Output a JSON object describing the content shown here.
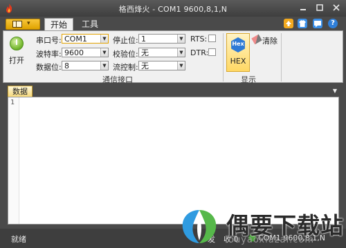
{
  "window": {
    "title": "格西烽火 - COM1  9600,8,1,N",
    "controls": [
      "minimize-icon",
      "restore-icon",
      "close-icon"
    ]
  },
  "ribbon": {
    "tabs": [
      {
        "label": "开始",
        "active": true
      },
      {
        "label": "工具",
        "active": false
      }
    ],
    "open_button": {
      "label": "打开"
    },
    "serial_group": {
      "label": "通信接口",
      "port_label": "串口号:",
      "port_value": "COM1",
      "baud_label": "波特率:",
      "baud_value": "9600",
      "databits_label": "数据位:",
      "databits_value": "8",
      "stopbits_label": "停止位:",
      "stopbits_value": "1",
      "parity_label": "校验位:",
      "parity_value": "无",
      "flow_label": "流控制:",
      "flow_value": "无",
      "rts_label": "RTS:",
      "rts_checked": false,
      "dtr_label": "DTR:",
      "dtr_checked": false
    },
    "display_group": {
      "label": "显示",
      "hex_button": "HEX",
      "hex_icon_text": "Hex",
      "hex_active": true,
      "clear_button": "清除"
    }
  },
  "data_panel": {
    "tab_label": "数据",
    "line_numbers": [
      "1"
    ]
  },
  "status_bar": {
    "ready": "就绪",
    "send": "发",
    "recv": "收 0",
    "port_status": "COM1 9600,8,1,N"
  },
  "watermark": {
    "title": "偶要下载站",
    "url": "ouyaoxiazai.com"
  },
  "colors": {
    "chrome_dark": "#4a4a4a",
    "ribbon_bg": "#f0f0f0",
    "accent_yellow": "#ffd864",
    "hex_blue": "#2d7ad6",
    "open_green": "#7cbd36"
  }
}
